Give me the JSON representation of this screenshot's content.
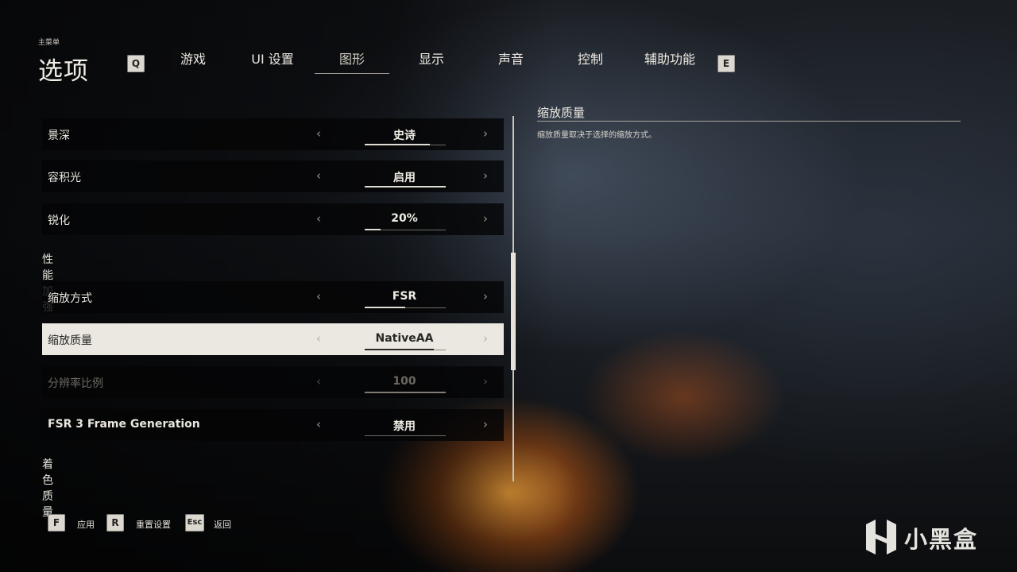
{
  "header": {
    "breadcrumb": "主菜单",
    "title": "选项",
    "prev_key": "Q",
    "next_key": "E",
    "tabs": [
      {
        "label": "游戏"
      },
      {
        "label": "UI 设置"
      },
      {
        "label": "图形"
      },
      {
        "label": "显示"
      },
      {
        "label": "声音"
      },
      {
        "label": "控制"
      },
      {
        "label": "辅助功能"
      }
    ],
    "active_tab": "图形"
  },
  "settings": {
    "rows": [
      {
        "label": "景深",
        "value": "史诗",
        "progress": 0.8
      },
      {
        "label": "容积光",
        "value": "启用",
        "progress": 1.0
      },
      {
        "label": "锐化",
        "value": "20%",
        "progress": 0.2
      },
      {
        "label": "缩放方式",
        "value": "FSR",
        "progress": 0.5
      },
      {
        "label": "缩放质量",
        "value": "NativeAA",
        "progress": 0.85
      },
      {
        "label": "分辨率比例",
        "value": "100",
        "progress": 1.0
      },
      {
        "label": "FSR 3 Frame Generation",
        "value": "禁用",
        "progress": 0.0
      }
    ],
    "sections": [
      "性能加强",
      "着色质量"
    ],
    "selected_row": "缩放质量",
    "disabled_row": "分辨率比例"
  },
  "description": {
    "title": "缩放质量",
    "text": "缩放质量取决于选择的缩放方式。"
  },
  "footer": {
    "apply_key": "F",
    "apply_label": "应用",
    "reset_key": "R",
    "reset_label": "重置设置",
    "back_key": "Esc",
    "back_label": "返回"
  },
  "watermark": {
    "text": "小黑盒"
  },
  "colors": {
    "selected_row_bg": "#ebe8e2",
    "row_bg": "#050506",
    "key_cap": "#dcd8cf"
  }
}
